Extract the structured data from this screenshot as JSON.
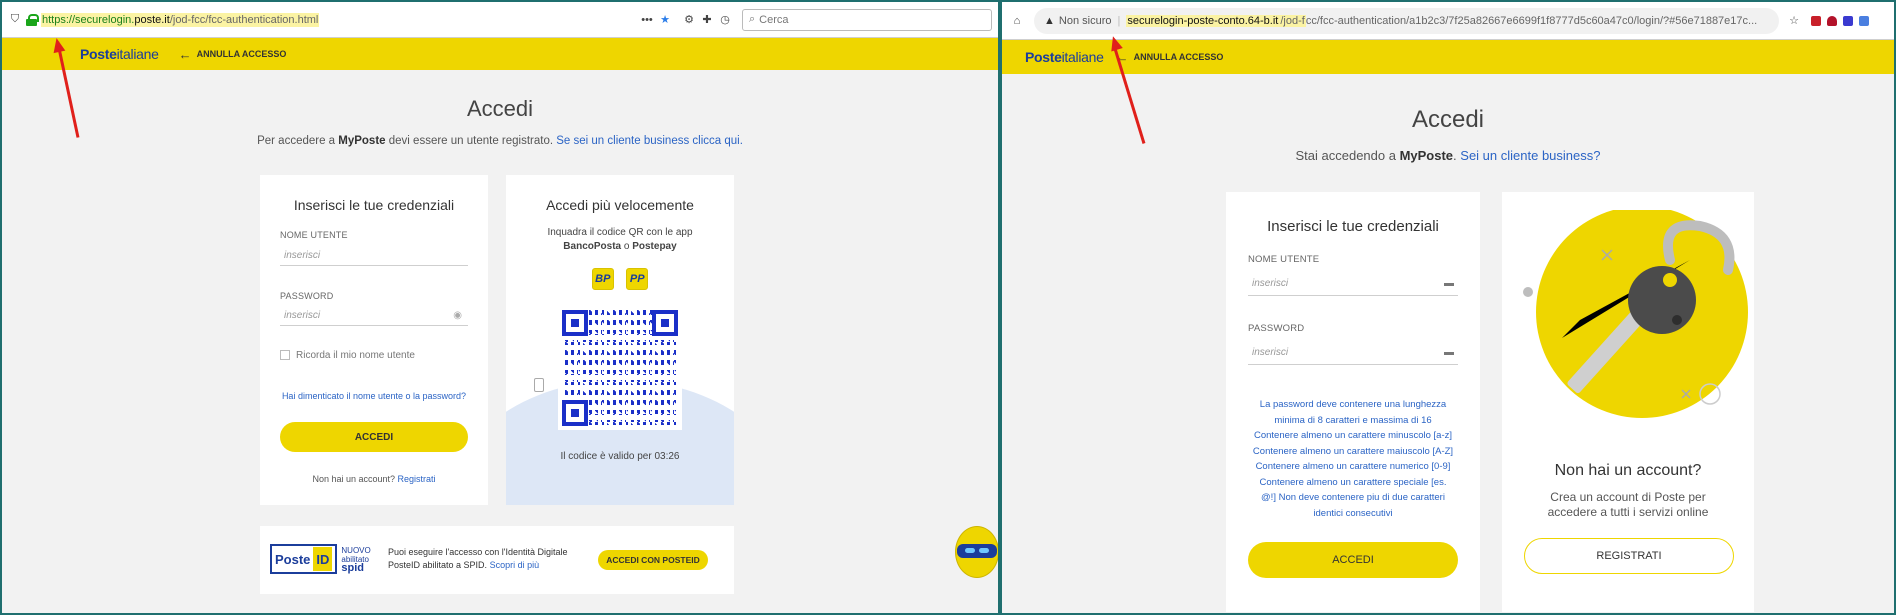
{
  "left": {
    "url": {
      "prefix": "https://securelogin.",
      "domain": "poste.it",
      "path": "/jod-fcc/fcc-authentication.html",
      "search_placeholder": "Cerca"
    },
    "header": {
      "logo_main": "Poste",
      "logo_sub": "italiane",
      "back_label": "ANNULLA ACCESSO"
    },
    "title": "Accedi",
    "subtitle": {
      "pre": "Per accedere a ",
      "brand": "MyPoste",
      "mid": " devi essere un utente registrato. ",
      "link": "Se sei un cliente business clicca qui."
    },
    "login_card": {
      "title": "Inserisci le tue credenziali",
      "username_label": "NOME UTENTE",
      "username_placeholder": "inserisci",
      "password_label": "PASSWORD",
      "password_placeholder": "inserisci",
      "remember_label": "Ricorda il mio nome utente",
      "forgot_link": "Hai dimenticato il nome utente o la password?",
      "submit_label": "ACCEDI",
      "no_account_text": "Non hai un account? ",
      "register_link": "Registrati"
    },
    "qr_card": {
      "title": "Accedi più velocemente",
      "line1": "Inquadra il codice QR con le app",
      "app1": "BancoPosta",
      "sep": " o ",
      "app2": "Postepay",
      "badge1": "BP",
      "badge2": "PP",
      "timer_text": "Il codice è valido per 03:26"
    },
    "posteid": {
      "logo_word": "Poste",
      "logo_id": "ID",
      "spid_line1": "NUOVO",
      "spid_line2": "abilitato",
      "spid_line3": "spid",
      "text": "Puoi eseguire l'accesso con l'Identità Digitale PosteID abilitato a SPID. ",
      "link": "Scopri di più",
      "button_label": "ACCEDI CON POSTEID"
    }
  },
  "right": {
    "url": {
      "warning": "Non sicuro",
      "domain": "securelogin-poste-conto.64-b.it",
      "path_hl": "/jod-f",
      "path": "cc/fcc-authentication/a1b2c3/7f25a82667e6699f1f8777d5c60a47c0/login/?#56e71887e17c..."
    },
    "header": {
      "logo_main": "Poste",
      "logo_sub": "italiane",
      "back_label": "ANNULLA ACCESSO"
    },
    "title": "Accedi",
    "subtitle": {
      "pre": "Stai accedendo a ",
      "brand": "MyPoste",
      "mid": ". ",
      "link": "Sei un cliente business?"
    },
    "login_card": {
      "title": "Inserisci le tue credenziali",
      "username_label": "NOME UTENTE",
      "username_placeholder": "inserisci",
      "password_label": "PASSWORD",
      "password_placeholder": "inserisci",
      "requirements": [
        "La password deve contenere una lunghezza",
        "minima di 8 caratteri e massima di 16",
        "Contenere almeno un carattere minuscolo [a-z]",
        "Contenere almeno un carattere maiuscolo [A-Z]",
        "Contenere almeno un carattere numerico [0-9]",
        "Contenere almeno un carattere speciale [es.",
        "@!] Non deve contenere piu di due caratteri",
        "identici consecutivi"
      ],
      "submit_label": "ACCEDI"
    },
    "register_card": {
      "title": "Non hai un account?",
      "text": "Crea un account di Poste per accedere a tutti i servizi online",
      "button_label": "REGISTRATI"
    }
  },
  "colors": {
    "brand_yellow": "#eed600",
    "brand_blue": "#1b3d9b",
    "link_blue": "#2b64c5",
    "annotation_red": "#e0201b"
  }
}
